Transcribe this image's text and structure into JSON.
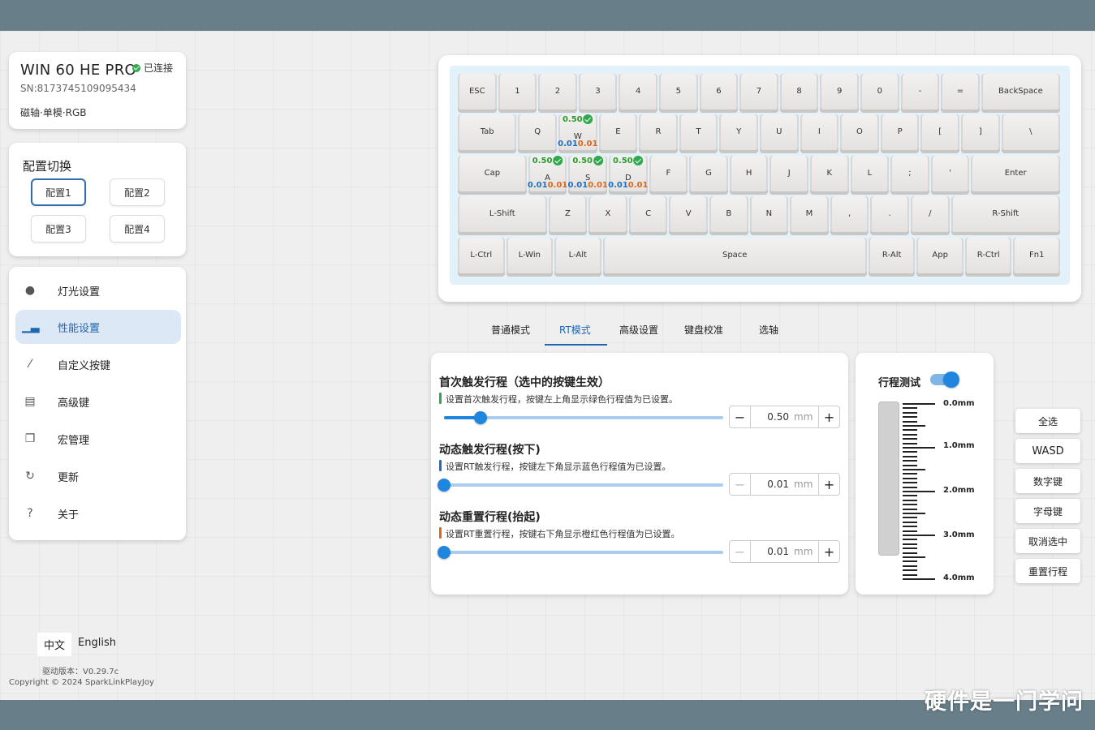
{
  "device": {
    "name": "WIN 60 HE PRO",
    "status": "已连接",
    "sn": "SN:8173745109095434",
    "type": "磁轴·单模·RGB"
  },
  "config": {
    "title": "配置切换",
    "buttons": [
      "配置1",
      "配置2",
      "配置3",
      "配置4"
    ],
    "active": "配置1"
  },
  "menu": {
    "items": [
      {
        "label": "灯光设置",
        "icon": "bulb-icon"
      },
      {
        "label": "性能设置",
        "icon": "bar-chart-icon"
      },
      {
        "label": "自定义按键",
        "icon": "key-remap-icon"
      },
      {
        "label": "高级键",
        "icon": "advanced-key-icon"
      },
      {
        "label": "宏管理",
        "icon": "macro-icon"
      },
      {
        "label": "更新",
        "icon": "refresh-icon"
      },
      {
        "label": "关于",
        "icon": "help-icon"
      }
    ],
    "active": "性能设置"
  },
  "language": {
    "options": [
      "中文",
      "English"
    ],
    "selected": "中文"
  },
  "footer": {
    "version": "驱动版本：V0.29.7c",
    "copyright": "Copyright © 2024 SparkLinkPlayJoy"
  },
  "keyboard": {
    "rows": [
      [
        "ESC",
        "1",
        "2",
        "3",
        "4",
        "5",
        "6",
        "7",
        "8",
        "9",
        "0",
        "-",
        "=",
        "BackSpace"
      ],
      [
        "Tab",
        "Q",
        "W",
        "E",
        "R",
        "T",
        "Y",
        "U",
        "I",
        "O",
        "P",
        "[",
        "]",
        "\\"
      ],
      [
        "Cap",
        "A",
        "S",
        "D",
        "F",
        "G",
        "H",
        "J",
        "K",
        "L",
        ";",
        "'",
        "Enter"
      ],
      [
        "L-Shift",
        "Z",
        "X",
        "C",
        "V",
        "B",
        "N",
        "M",
        ",",
        ".",
        "/",
        "R-Shift"
      ],
      [
        "L-Ctrl",
        "L-Win",
        "L-Alt",
        "Space",
        "R-Alt",
        "App",
        "R-Ctrl",
        "Fn1"
      ]
    ],
    "selected_keys": {
      "W": {
        "actuation": "0.50",
        "press": "0.01",
        "release": "0.01"
      },
      "A": {
        "actuation": "0.50",
        "press": "0.01",
        "release": "0.01"
      },
      "S": {
        "actuation": "0.50",
        "press": "0.01",
        "release": "0.01"
      },
      "D": {
        "actuation": "0.50",
        "press": "0.01",
        "release": "0.01"
      }
    }
  },
  "tabs": {
    "items": [
      "普通模式",
      "RT模式",
      "高级设置",
      "键盘校准",
      "选轴"
    ],
    "active": "RT模式"
  },
  "settings": {
    "sections": [
      {
        "title": "首次触发行程（选中的按键生效）",
        "desc": "设置首次触发行程，按键左上角显示绿色行程值为已设置。",
        "value": "0.50",
        "unit": "mm",
        "fraction": 0.13,
        "minus_disabled": false
      },
      {
        "title": "动态触发行程(按下)",
        "desc": "设置RT触发行程，按键左下角显示蓝色行程值为已设置。",
        "value": "0.01",
        "unit": "mm",
        "fraction": 0.0,
        "minus_disabled": true
      },
      {
        "title": "动态重置行程(抬起)",
        "desc": "设置RT重置行程，按键右下角显示橙红色行程值为已设置。",
        "value": "0.01",
        "unit": "mm",
        "fraction": 0.0,
        "minus_disabled": true
      }
    ]
  },
  "travel_test": {
    "title": "行程测试",
    "enabled": true,
    "labels": [
      "0.0mm",
      "1.0mm",
      "2.0mm",
      "3.0mm",
      "4.0mm"
    ]
  },
  "actions": [
    "全选",
    "WASD",
    "数字键",
    "字母键",
    "取消选中",
    "重置行程"
  ],
  "watermark": "硬件是一门学问"
}
